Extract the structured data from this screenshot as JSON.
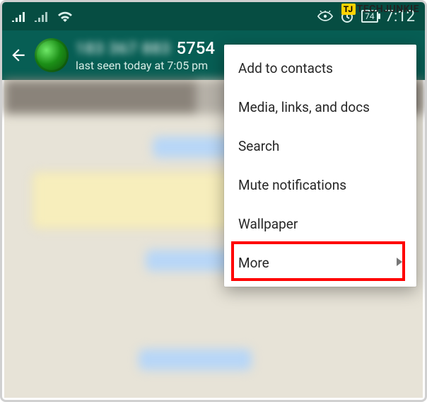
{
  "watermark": {
    "badge": "TJ",
    "text": "TECHJUNKIE"
  },
  "statusbar": {
    "battery": "74",
    "time": "7:12"
  },
  "appbar": {
    "contact_obscured": "183 367 883",
    "contact_number_suffix": "5754",
    "last_seen": "last seen today at 7:05 pm"
  },
  "menu": {
    "items": [
      {
        "label": "Add to contacts"
      },
      {
        "label": "Media, links, and docs"
      },
      {
        "label": "Search"
      },
      {
        "label": "Mute notifications"
      },
      {
        "label": "Wallpaper"
      },
      {
        "label": "More",
        "has_submenu": true
      }
    ]
  }
}
